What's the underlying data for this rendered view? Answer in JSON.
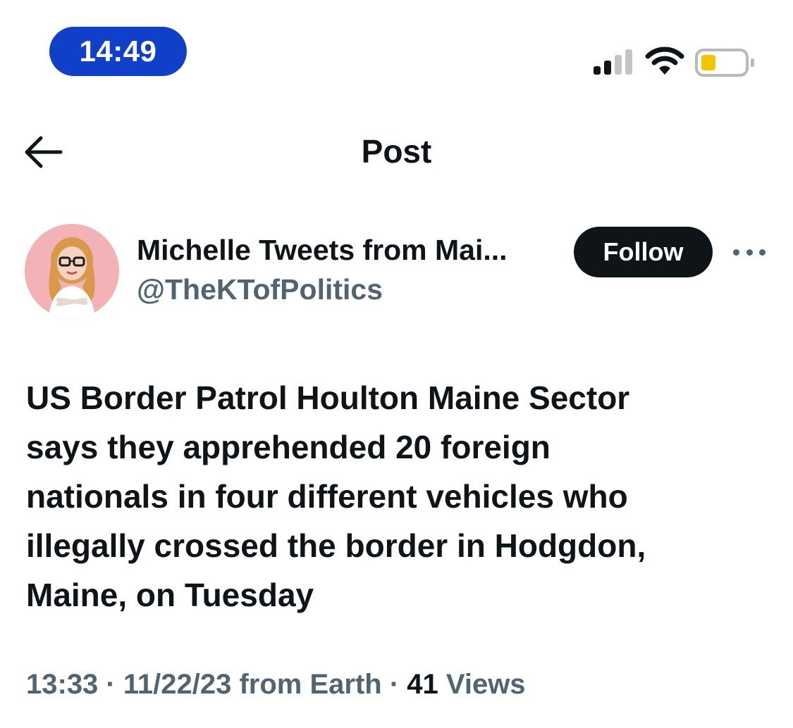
{
  "status_bar": {
    "time": "14:49",
    "signal_icon": "cellular-signal-icon",
    "wifi_icon": "wifi-icon",
    "battery_icon": "battery-low-icon",
    "battery_fill_color": "#f5c400",
    "time_pill_color": "#1040c8"
  },
  "header": {
    "back_icon": "back-arrow-icon",
    "title": "Post"
  },
  "author": {
    "display_name": "Michelle Tweets from Mai...",
    "handle": "@TheKTofPolitics",
    "follow_label": "Follow",
    "more_icon": "more-options-icon",
    "avatar_bg": "#f2b2b6"
  },
  "tweet": {
    "text": "US Border Patrol Houlton Maine Sector\nsays they apprehended 20 foreign\nnationals in four different vehicles who\nillegally crossed the border in Hodgdon,\nMaine, on Tuesday"
  },
  "meta": {
    "time": "13:33",
    "separator": " · ",
    "date": "11/22/23",
    "source": " from Earth",
    "views_count": "41",
    "views_label": " Views"
  }
}
